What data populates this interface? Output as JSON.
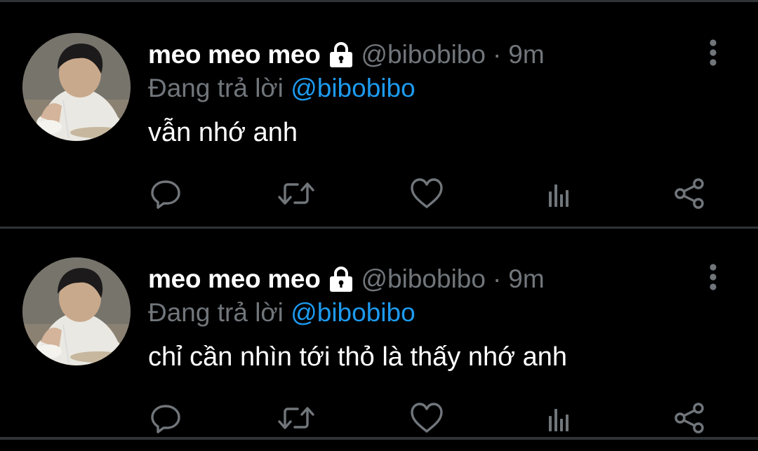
{
  "colors": {
    "background": "#000000",
    "divider": "#2f3336",
    "secondary_text": "#71767b",
    "mention": "#1d9bf0",
    "primary_text": "#ffffff"
  },
  "tweets": [
    {
      "display_name": "meo meo meo",
      "protected_icon": "lock-icon",
      "handle": "@bibobibo",
      "separator": "·",
      "time": "9m",
      "reply_prefix": "Đang trả lời",
      "reply_mention": "@bibobibo",
      "text": "vẫn nhớ anh",
      "actions": [
        "reply-icon",
        "retweet-icon",
        "like-icon",
        "views-icon",
        "share-icon"
      ]
    },
    {
      "display_name": "meo meo meo",
      "protected_icon": "lock-icon",
      "handle": "@bibobibo",
      "separator": "·",
      "time": "9m",
      "reply_prefix": "Đang trả lời",
      "reply_mention": "@bibobibo",
      "text": "chỉ cần nhìn tới thỏ là thấy nhớ anh",
      "actions": [
        "reply-icon",
        "retweet-icon",
        "like-icon",
        "views-icon",
        "share-icon"
      ]
    }
  ]
}
